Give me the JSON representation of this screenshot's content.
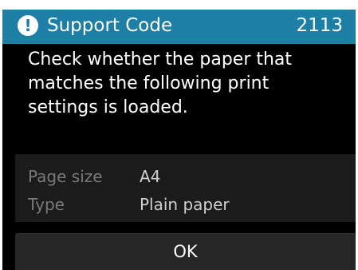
{
  "header": {
    "icon": "exclamation-icon",
    "title": "Support Code",
    "code": "2113"
  },
  "message": {
    "lines": [
      "Check whether the paper that",
      "matches the following print",
      "settings is loaded."
    ]
  },
  "settings": [
    {
      "label": "Page size",
      "value": "A4"
    },
    {
      "label": "Type",
      "value": "Plain paper"
    }
  ],
  "actions": {
    "ok_label": "OK"
  },
  "colors": {
    "title_bar": "#1e7fa6",
    "screen_background": "#000000",
    "panel_background": "#1b1b1b",
    "label_text": "#7a7a7a"
  }
}
